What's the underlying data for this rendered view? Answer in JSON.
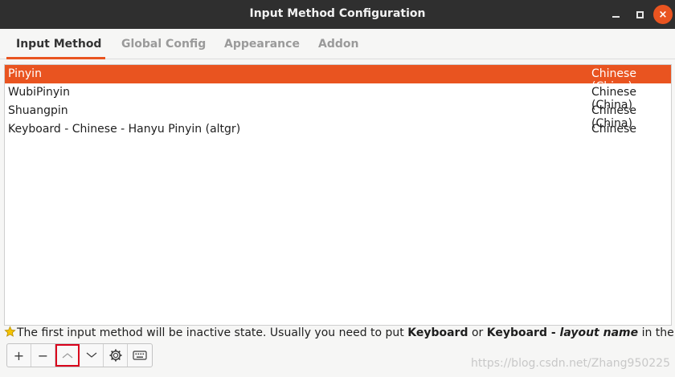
{
  "window": {
    "title": "Input Method Configuration",
    "close_glyph": "×"
  },
  "tabs": [
    {
      "label": "Input Method",
      "active": true
    },
    {
      "label": "Global Config",
      "active": false
    },
    {
      "label": "Appearance",
      "active": false
    },
    {
      "label": "Addon",
      "active": false
    }
  ],
  "input_methods": [
    {
      "name": "Pinyin",
      "language": "Chinese (China)",
      "selected": true
    },
    {
      "name": "WubiPinyin",
      "language": "Chinese (China)",
      "selected": false
    },
    {
      "name": "Shuangpin",
      "language": "Chinese (China)",
      "selected": false
    },
    {
      "name": "Keyboard - Chinese - Hanyu Pinyin (altgr)",
      "language": "Chinese",
      "selected": false
    }
  ],
  "hint": {
    "icon": "star-icon",
    "text_1": "The first input method will be inactive state. Usually you need to put ",
    "bold_1": "Keyboard",
    "text_2": " or ",
    "bold_2": "Keyboard - ",
    "italic": "layout name",
    "text_3": " in the first place."
  },
  "toolbar": {
    "buttons": [
      {
        "icon": "add-icon",
        "glyph": "+"
      },
      {
        "icon": "remove-icon",
        "glyph": "−"
      },
      {
        "icon": "move-up-icon",
        "glyph": "︿",
        "highlighted": true
      },
      {
        "icon": "move-down-icon",
        "glyph": "﹀"
      },
      {
        "icon": "configure-icon",
        "glyph": "⚙"
      },
      {
        "icon": "keyboard-icon",
        "glyph": "⌨"
      }
    ]
  },
  "watermark": "https://blog.csdn.net/Zhang950225",
  "colors": {
    "accent": "#e95420",
    "titlebar": "#2f2f2f",
    "highlight_box": "#d9001b"
  }
}
